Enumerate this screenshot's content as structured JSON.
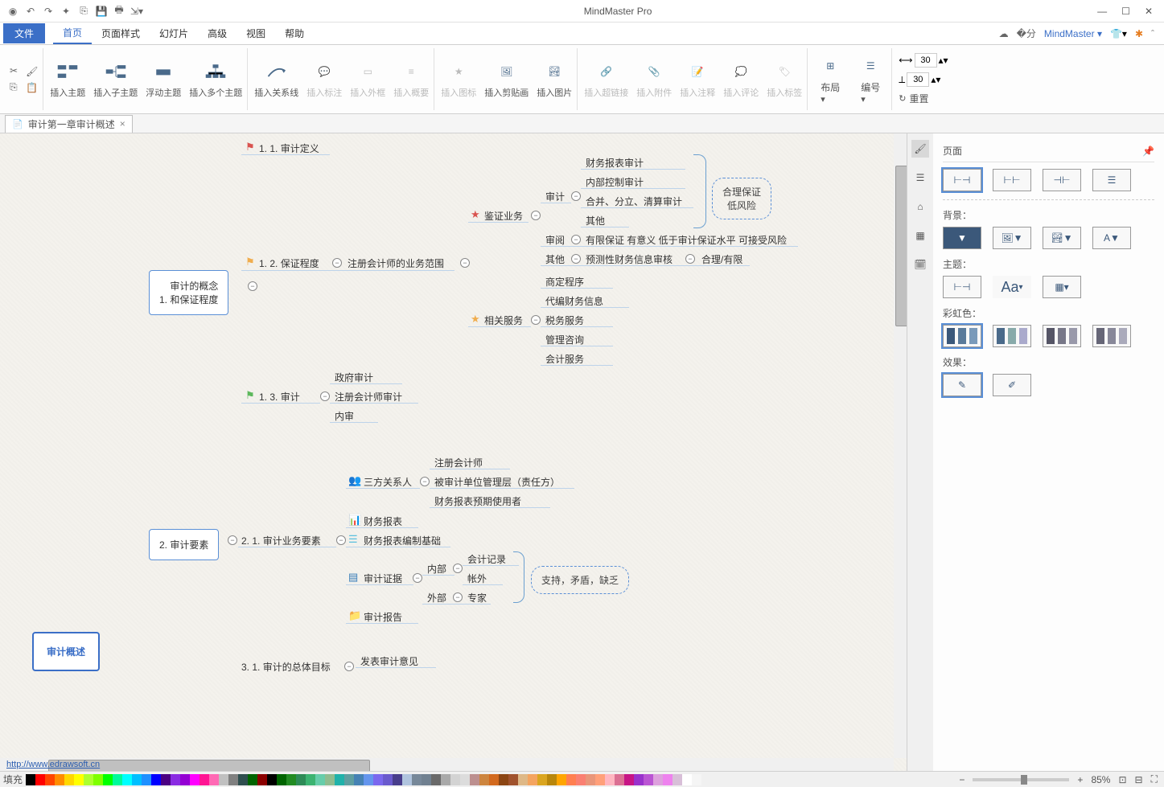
{
  "app": {
    "title": "MindMaster Pro"
  },
  "menu": {
    "file": "文件",
    "tabs": [
      "首页",
      "页面样式",
      "幻灯片",
      "高级",
      "视图",
      "帮助"
    ],
    "brand": "MindMaster"
  },
  "ribbon": {
    "insertTopic": "插入主题",
    "insertSub": "插入子主题",
    "floatTopic": "浮动主题",
    "multiTopic": "插入多个主题",
    "relation": "插入关系线",
    "callout": "插入标注",
    "boundary": "插入外框",
    "summary": "插入概要",
    "icon": "插入图标",
    "clipart": "插入剪贴画",
    "image": "插入图片",
    "hyperlink": "插入超链接",
    "attach": "插入附件",
    "note": "插入注释",
    "comment": "插入评论",
    "tag": "插入标签",
    "layout": "布局",
    "number": "编号",
    "w": "30",
    "h": "30",
    "reset": "重置"
  },
  "doc": {
    "tab": "审计第一章审计概述"
  },
  "root": "审计概述",
  "n1": {
    "t": "审计的概念\n和保证程度",
    "num": "1."
  },
  "n11": {
    "t": "审计定义",
    "num": "1. 1."
  },
  "n12": {
    "t": "保证程度",
    "num": "1. 2.",
    "r": "注册会计师的业务范围"
  },
  "n12a": {
    "t": "鉴证业务"
  },
  "n12b": {
    "t": "相关服务"
  },
  "audit": {
    "t": "审计",
    "items": [
      "财务报表审计",
      "内部控制审计",
      "合并、分立、清算审计",
      "其他"
    ]
  },
  "review": {
    "t": "审阅",
    "d": "有限保证 有意义 低于审计保证水平 可接受风险"
  },
  "other": {
    "t": "其他",
    "d": "预测性财务信息审核",
    "r": "合理/有限"
  },
  "related": [
    "商定程序",
    "代编财务信息",
    "税务服务",
    "管理咨询",
    "会计服务"
  ],
  "callout1": "合理保证\n低风险",
  "n13": {
    "t": "审计",
    "num": "1. 3.",
    "items": [
      "政府审计",
      "注册会计师审计",
      "内审"
    ]
  },
  "n2": {
    "t": "审计要素",
    "num": "2."
  },
  "n21": {
    "t": "审计业务要素",
    "num": "2. 1."
  },
  "threep": {
    "t": "三方关系人",
    "items": [
      "注册会计师",
      "被审计单位管理层（责任方）",
      "财务报表预期使用者"
    ]
  },
  "fs": "财务报表",
  "fsbasis": "财务报表编制基础",
  "evidence": "审计证据",
  "report": "审计报告",
  "internal": {
    "t": "内部",
    "items": [
      "会计记录",
      "帐外"
    ]
  },
  "external": {
    "t": "外部",
    "r": "专家"
  },
  "callout2": "支持，矛盾，缺乏",
  "n31": {
    "t": "审计的总体目标",
    "num": "3. 1.",
    "r": "发表审计意见"
  },
  "rpanel": {
    "title": "页面",
    "bg": "背景：",
    "theme": "主题：",
    "rainbow": "彩虹色：",
    "effect": "效果："
  },
  "status": {
    "fill": "填充",
    "zoom": "85%",
    "url": "http://www.edrawsoft.cn"
  },
  "palette": [
    "#000000",
    "#ff0000",
    "#ff4500",
    "#ff8c00",
    "#ffd700",
    "#ffff00",
    "#adff2f",
    "#7fff00",
    "#00ff00",
    "#00fa9a",
    "#00ffff",
    "#00bfff",
    "#1e90ff",
    "#0000ff",
    "#4b0082",
    "#8a2be2",
    "#9400d3",
    "#ff00ff",
    "#ff1493",
    "#ff69b4",
    "#c0c0c0",
    "#808080",
    "#2f4f4f",
    "#006400",
    "#8b0000",
    "#000000",
    "#006400",
    "#228b22",
    "#2e8b57",
    "#3cb371",
    "#66cdaa",
    "#8fbc8f",
    "#20b2aa",
    "#5f9ea0",
    "#4682b4",
    "#6495ed",
    "#7b68ee",
    "#6a5acd",
    "#483d8b",
    "#b0c4de",
    "#778899",
    "#708090",
    "#696969",
    "#a9a9a9",
    "#d3d3d3",
    "#dcdcdc",
    "#bc8f8f",
    "#cd853f",
    "#d2691e",
    "#8b4513",
    "#a0522d",
    "#deb887",
    "#f4a460",
    "#daa520",
    "#b8860b",
    "#ffa500",
    "#ff7f50",
    "#fa8072",
    "#e9967a",
    "#ffa07a",
    "#ffb6c1",
    "#db7093",
    "#c71585",
    "#9932cc",
    "#ba55d3",
    "#dda0dd",
    "#ee82ee",
    "#d8bfd8",
    "#ffffff",
    "#f5f5f5"
  ]
}
